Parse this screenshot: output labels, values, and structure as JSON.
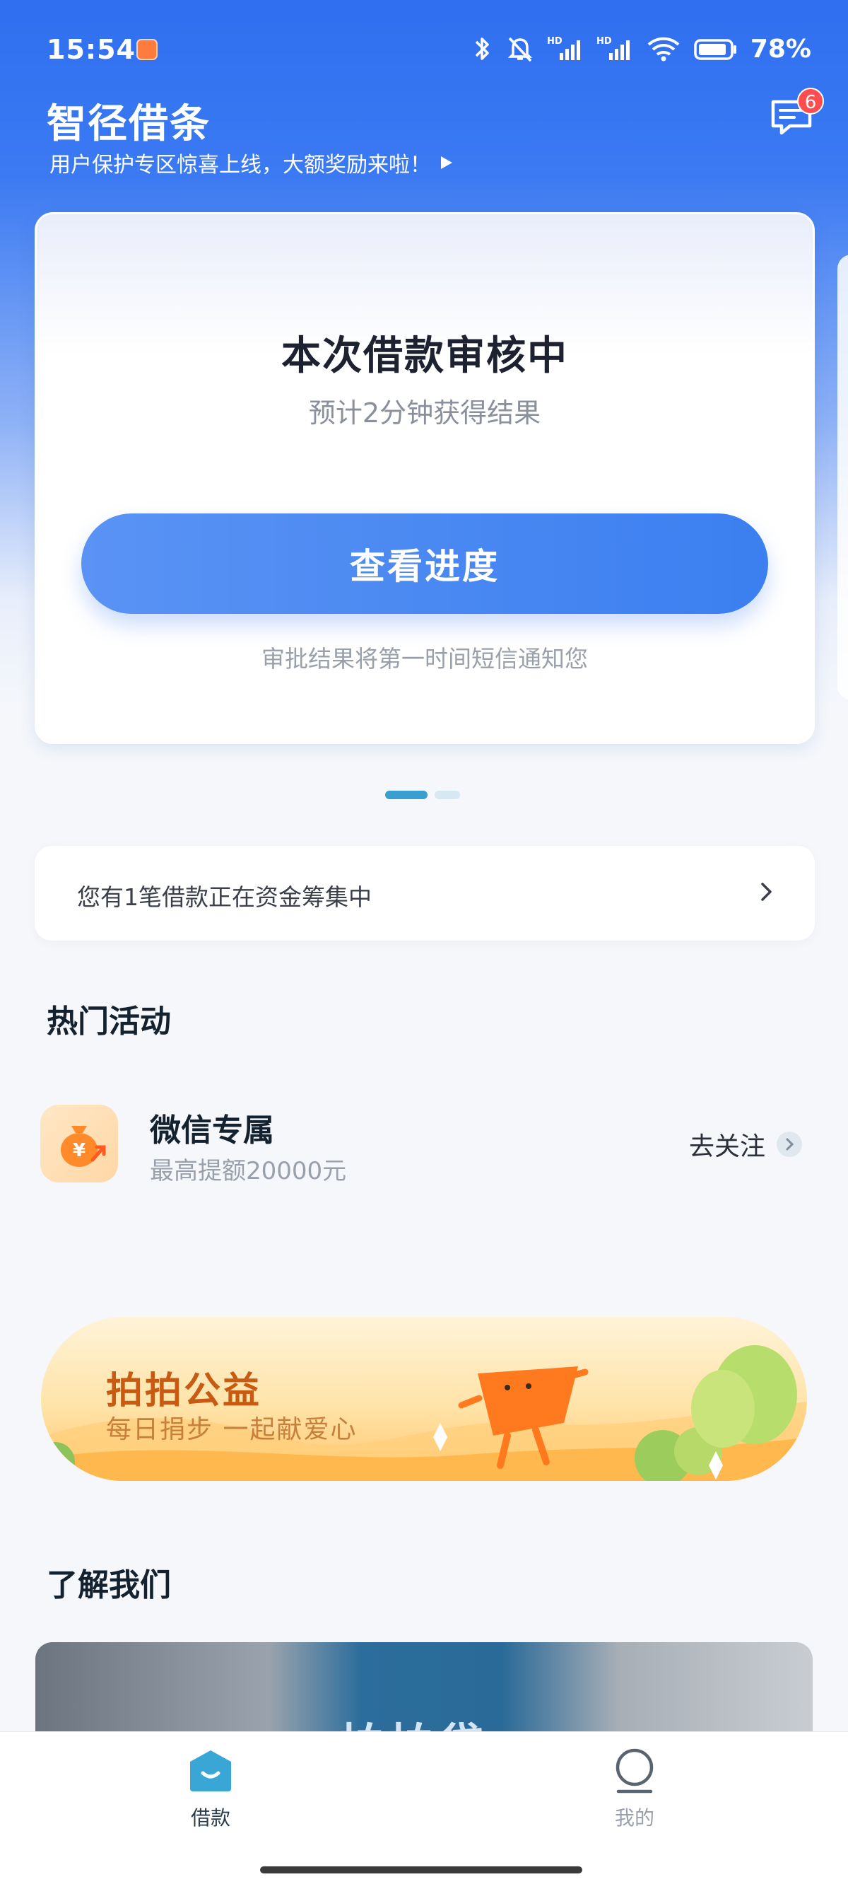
{
  "status_bar": {
    "time": "15:54",
    "battery": "78%",
    "icons": [
      "app-shield-icon",
      "bluetooth-icon",
      "mute-bell-icon",
      "hd-signal-icon",
      "hd-signal-icon",
      "wifi-icon",
      "battery-icon"
    ]
  },
  "header": {
    "app_title": "智径借条",
    "promo_text": "用户保护专区惊喜上线，大额奖励来啦！",
    "message_badge": "6",
    "message_icon": "chat-bubble-icon"
  },
  "loan_card": {
    "title": "本次借款审核中",
    "subtitle": "预计2分钟获得结果",
    "button_label": "查看进度",
    "note": "审批结果将第一时间短信通知您"
  },
  "pager": {
    "total": 2,
    "active": 1
  },
  "notice": {
    "text": "您有1笔借款正在资金筹集中"
  },
  "hot_activities": {
    "section_title": "热门活动",
    "item": {
      "name": "微信专属",
      "desc": "最高提额20000元",
      "action": "去关注",
      "icon": "money-bag-icon"
    }
  },
  "banner": {
    "title": "拍拍公益",
    "subtitle": "每日捐步 一起献爱心"
  },
  "about": {
    "section_title": "了解我们",
    "image_text": "拍拍贷"
  },
  "tabbar": {
    "tabs": [
      {
        "label": "借款",
        "icon": "loan-tab-icon",
        "active": true
      },
      {
        "label": "我的",
        "icon": "profile-tab-icon",
        "active": false
      }
    ]
  },
  "colors": {
    "brand_blue": "#3b7af2",
    "button_blue": "#4a88f2",
    "badge_red": "#ff4d4f",
    "tab_active": "#3aa6d6",
    "banner_orange": "#c85a12"
  }
}
